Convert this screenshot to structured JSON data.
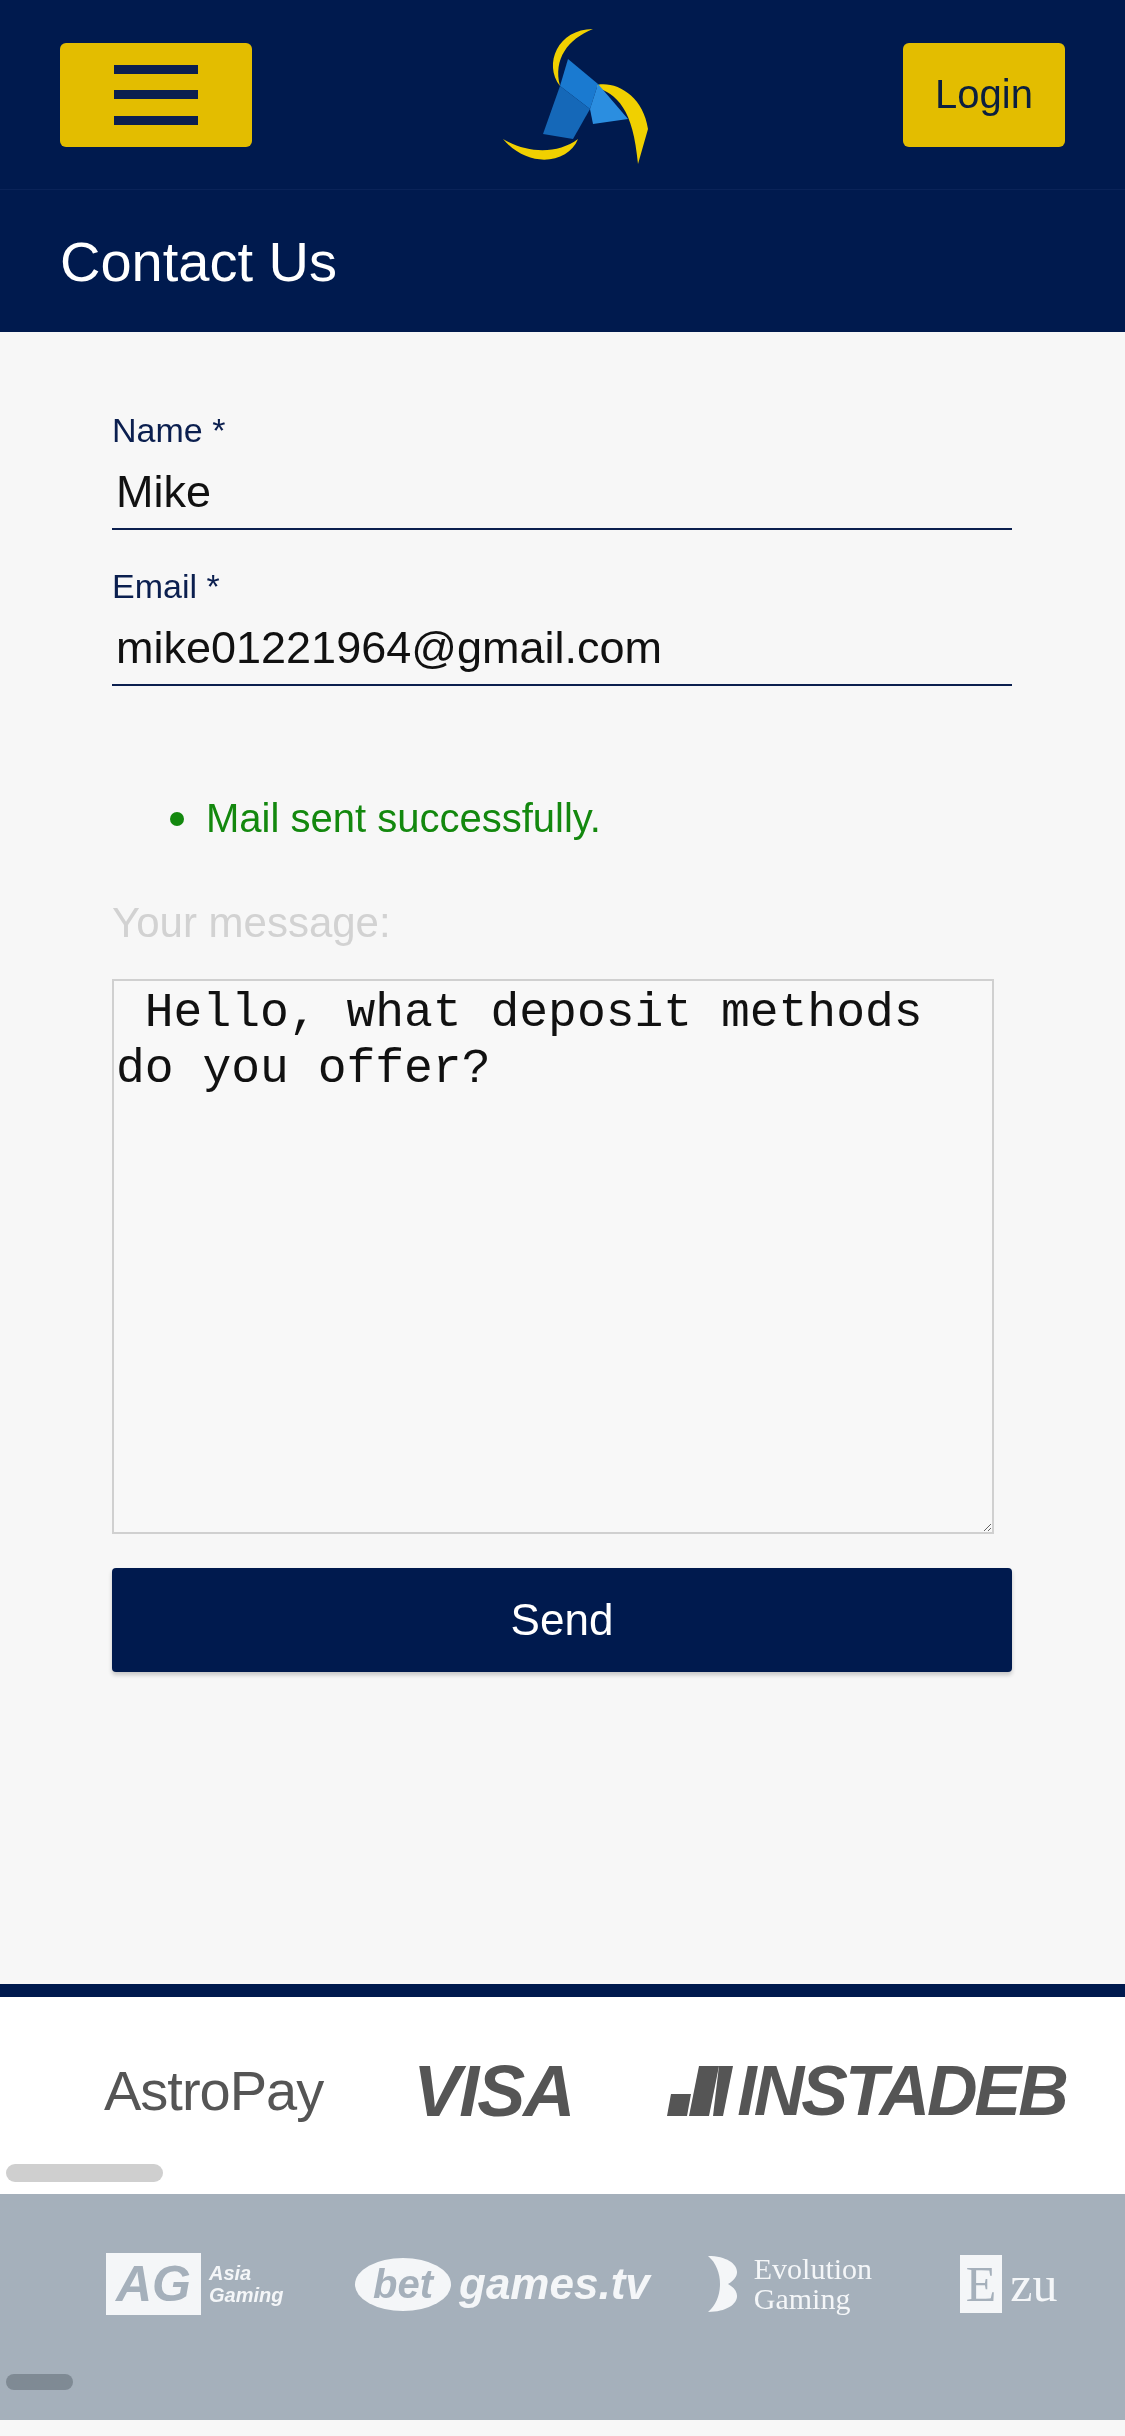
{
  "header": {
    "login_button": "Login"
  },
  "page_title": "Contact Us",
  "form": {
    "fields": [
      {
        "label": "Name *",
        "value": "Mike"
      },
      {
        "label": "Email *",
        "value": "mike01221964@gmail.com"
      }
    ],
    "messages": [
      {
        "text": "Mail sent successfully.",
        "kind": "success"
      }
    ],
    "message_label": "Your message:",
    "message_value": " Hello, what deposit methods do you offer?",
    "send_button": "Send"
  },
  "payment_logos": [
    {
      "kind": "astropay",
      "text": "AstroPay"
    },
    {
      "kind": "visa",
      "text": "VISA"
    },
    {
      "kind": "instadebit",
      "text": "INSTADEB"
    }
  ],
  "provider_logos": [
    {
      "kind": "ag",
      "mark": "AG",
      "text": "Asia Gaming"
    },
    {
      "kind": "betgames",
      "mark": "bet",
      "text": "games.tv"
    },
    {
      "kind": "evolution",
      "text": "Evolution Gaming"
    },
    {
      "kind": "ezugi",
      "mark": "E",
      "text": "zu"
    }
  ]
}
